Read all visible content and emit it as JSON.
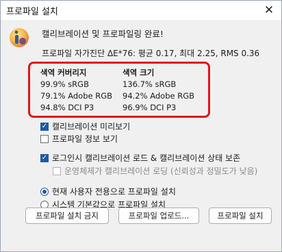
{
  "window": {
    "title": "프로파일 설치",
    "close_glyph": "✕"
  },
  "message": {
    "heading": "캘리브레이션 및 프로파일링 완료!",
    "verification": "프로파일 자가진단 ΔE*76: 평균 0.17, 최대 2.25, RMS 0.36"
  },
  "gamut": {
    "highlight_color": "#e0151b",
    "coverage": {
      "header": "색역 커버리지",
      "rows": [
        "99.9% sRGB",
        "79.1% Adobe RGB",
        "94.8% DCI P3"
      ]
    },
    "volume": {
      "header": "색역 크기",
      "rows": [
        "136.7% sRGB",
        "94.2% Adobe RGB",
        "96.9% DCI P3"
      ]
    }
  },
  "options": {
    "preview_calibration": {
      "label": "캘리브레이션 미리보기",
      "checked": true
    },
    "show_profile_info": {
      "label": "프로파일 정보 보기",
      "checked": false
    },
    "load_on_login": {
      "label": "로그인시 캘리브레이션 로드 & 캘리브레이션 상태 보존",
      "checked": true
    },
    "os_load": {
      "label": "운영체제가 캘리브레이션 로딩 (신뢰성과 정밀도가 낮음)",
      "checked": false,
      "enabled": false
    },
    "install_current_user": {
      "label": "현재 사용자 전용으로 프로파일 설치",
      "selected": true
    },
    "install_system_default": {
      "label": "시스템 기본값으로 프로파일 설치",
      "selected": false
    }
  },
  "buttons": {
    "dont_install": "프로파일 설치 금지",
    "upload": "프로파일 업로드...",
    "install": "프로파일 설치"
  },
  "icons": {
    "info": "info-icon",
    "close": "close-icon",
    "check": "checkmark-icon"
  },
  "colors": {
    "accent": "#1f5aa6",
    "window_bg": "#f0f0f0"
  }
}
